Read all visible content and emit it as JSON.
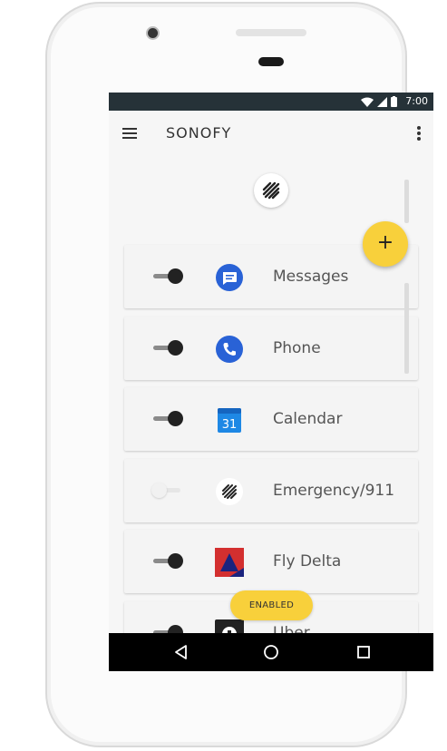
{
  "status_bar": {
    "time": "7:00"
  },
  "app_bar": {
    "title": "SONOFY"
  },
  "fab": {
    "label": "+"
  },
  "apps": [
    {
      "label": "Messages",
      "enabled": true,
      "icon": "messages-icon"
    },
    {
      "label": "Phone",
      "enabled": true,
      "icon": "phone-icon"
    },
    {
      "label": "Calendar",
      "enabled": true,
      "icon": "calendar-icon",
      "icon_text": "31"
    },
    {
      "label": "Emergency/911",
      "enabled": false,
      "icon": "sonofy-logo-icon"
    },
    {
      "label": "Fly Delta",
      "enabled": true,
      "icon": "delta-icon"
    },
    {
      "label": "Uber",
      "enabled": true,
      "icon": "uber-icon"
    }
  ],
  "snackbar": {
    "text": "ENABLED"
  },
  "colors": {
    "status_bar": "#263238",
    "accent": "#f8d03b",
    "messages_blue": "#2962d6",
    "phone_blue": "#2962d6",
    "calendar_blue": "#1e88e5",
    "delta_red": "#d32f2f",
    "delta_navy": "#1a237e"
  }
}
